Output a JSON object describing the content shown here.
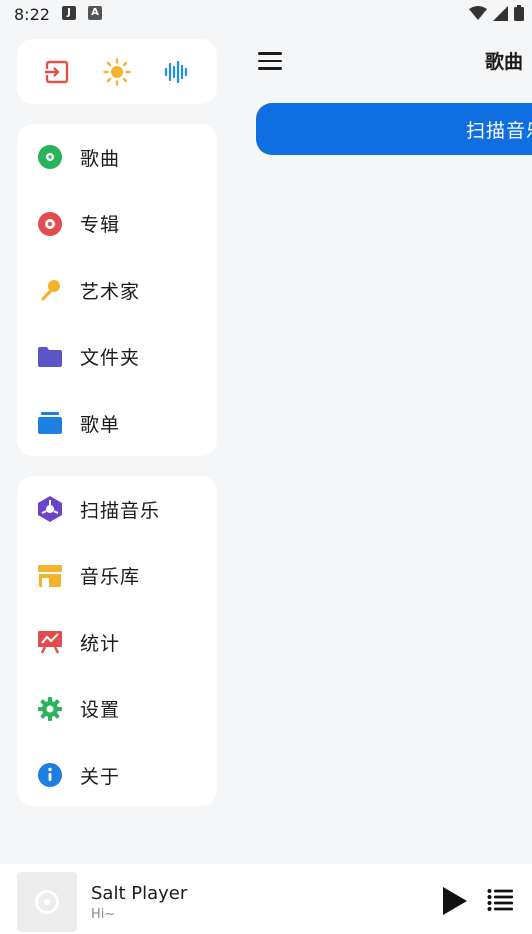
{
  "status_bar": {
    "time": "8:22",
    "notif1": "J",
    "notif2": "A"
  },
  "quick_actions": [
    {
      "icon": "logout-icon",
      "color": "#e4534a"
    },
    {
      "icon": "sun-icon",
      "color": "#f3b32c"
    },
    {
      "icon": "audio-waveform-icon",
      "color": "#1f8fe0"
    }
  ],
  "nav_primary": [
    {
      "label": "歌曲",
      "icon": "song-icon",
      "color": "#29b35a"
    },
    {
      "label": "专辑",
      "icon": "album-icon",
      "color": "#e14c4c"
    },
    {
      "label": "艺术家",
      "icon": "microphone-icon",
      "color": "#f3b32c"
    },
    {
      "label": "文件夹",
      "icon": "folder-icon",
      "color": "#5b55c6"
    },
    {
      "label": "歌单",
      "icon": "playlist-icon",
      "color": "#1f7fe0"
    }
  ],
  "nav_secondary": [
    {
      "label": "扫描音乐",
      "icon": "scan-icon",
      "color": "#6a44c9"
    },
    {
      "label": "音乐库",
      "icon": "library-icon",
      "color": "#f3b32c"
    },
    {
      "label": "统计",
      "icon": "chart-icon",
      "color": "#e14c4c"
    },
    {
      "label": "设置",
      "icon": "gear-icon",
      "color": "#29b35a"
    },
    {
      "label": "关于",
      "icon": "info-icon",
      "color": "#1f7fe0"
    }
  ],
  "header": {
    "title": "歌曲"
  },
  "scan_button": {
    "label": "扫描音乐"
  },
  "player": {
    "title": "Salt Player",
    "subtitle": "Hi~"
  }
}
